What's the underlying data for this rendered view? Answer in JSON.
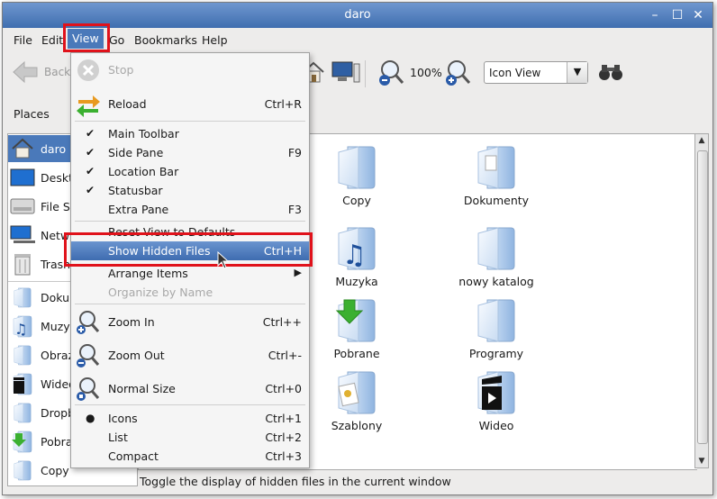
{
  "window": {
    "title": "daro"
  },
  "menubar": {
    "items": [
      "File",
      "Edit",
      "View",
      "Go",
      "Bookmarks",
      "Help"
    ]
  },
  "toolbar": {
    "back_label": "Back",
    "zoom_level": "100%",
    "view_mode": "Icon View"
  },
  "side": {
    "header": "Places",
    "items": [
      {
        "label": "daro",
        "icon": "home-icon",
        "selected": true
      },
      {
        "label": "Deskt",
        "icon": "desktop-icon"
      },
      {
        "label": "File Sy",
        "icon": "drive-icon"
      },
      {
        "label": "Netw",
        "icon": "network-icon"
      },
      {
        "label": "Trash",
        "icon": "trash-icon"
      },
      {
        "label": "Doku",
        "icon": "folder-icon"
      },
      {
        "label": "Muzy",
        "icon": "music-folder-icon"
      },
      {
        "label": "Obraz",
        "icon": "folder-icon"
      },
      {
        "label": "Wideo",
        "icon": "video-folder-icon"
      },
      {
        "label": "Dropb",
        "icon": "folder-icon"
      },
      {
        "label": "Pobra",
        "icon": "download-folder-icon"
      },
      {
        "label": "Copy",
        "icon": "folder-icon"
      }
    ]
  },
  "files": [
    {
      "name": "Copy",
      "icon": "folder-icon"
    },
    {
      "name": "Dokumenty",
      "icon": "documents-folder-icon"
    },
    {
      "name": "Muzyka",
      "icon": "music-folder-icon"
    },
    {
      "name": "nowy katalog",
      "icon": "folder-icon"
    },
    {
      "name": "Pobrane",
      "icon": "download-folder-icon"
    },
    {
      "name": "Programy",
      "icon": "folder-icon"
    },
    {
      "name": "Szablony",
      "icon": "templates-folder-icon"
    },
    {
      "name": "Wideo",
      "icon": "video-folder-icon"
    }
  ],
  "status": {
    "text": "Toggle the display of hidden files in the current window"
  },
  "view_menu": {
    "items": [
      {
        "label": "Stop",
        "accel": "",
        "disabled": true
      },
      {
        "label": "Reload",
        "accel": "Ctrl+R"
      },
      {
        "label": "Main Toolbar",
        "accel": "",
        "checked": true
      },
      {
        "label": "Side Pane",
        "accel": "F9",
        "checked": true
      },
      {
        "label": "Location Bar",
        "accel": "",
        "checked": true
      },
      {
        "label": "Statusbar",
        "accel": "",
        "checked": true
      },
      {
        "label": "Extra Pane",
        "accel": "F3"
      },
      {
        "label": "Reset View to Defaults",
        "accel": ""
      },
      {
        "label": "Show Hidden Files",
        "accel": "Ctrl+H",
        "highlighted": true
      },
      {
        "label": "Arrange Items",
        "accel": ""
      },
      {
        "label": "Organize by Name",
        "accel": "",
        "disabled": true
      },
      {
        "label": "Zoom In",
        "accel": "Ctrl++"
      },
      {
        "label": "Zoom Out",
        "accel": "Ctrl+-"
      },
      {
        "label": "Normal Size",
        "accel": "Ctrl+0"
      },
      {
        "label": "Icons",
        "accel": "Ctrl+1",
        "radio_selected": true
      },
      {
        "label": "List",
        "accel": "Ctrl+2"
      },
      {
        "label": "Compact",
        "accel": "Ctrl+3"
      }
    ]
  },
  "colors": {
    "accent": "#4a79ba",
    "highlight_box": "#e0121b",
    "folder": "#9cc0ea"
  }
}
